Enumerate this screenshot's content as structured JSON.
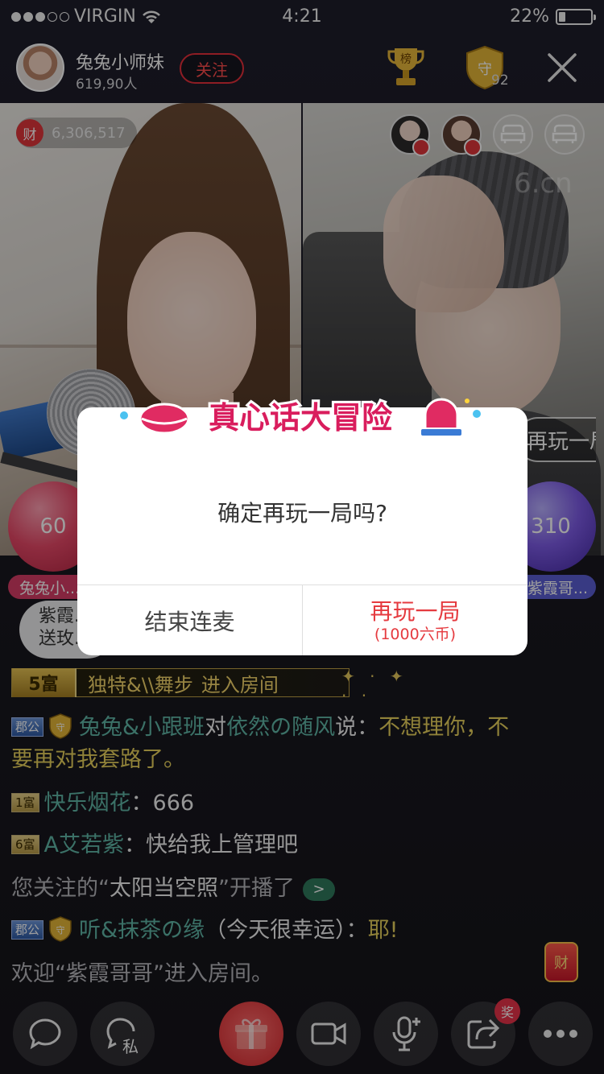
{
  "status_bar": {
    "carrier": "VIRGIN",
    "time": "4:21",
    "battery": "22%",
    "battery_level": 0.22
  },
  "header": {
    "host_name": "兔兔小师妹",
    "audience_count": "619,90人",
    "follow_label": "关注",
    "rank_label": "榜",
    "guard_label": "守",
    "guard_count": "92"
  },
  "left_stream": {
    "wealth_label": "财",
    "wealth_value": "6,306,517",
    "score": "60",
    "name": "兔兔小...",
    "gift_notice": [
      "紫霞...",
      "送玫..."
    ]
  },
  "right_stream": {
    "watermark": "6.cn",
    "play_again_pill": "再玩一局",
    "score": "310",
    "name": "紫霞哥..."
  },
  "dialog": {
    "title": "真心话大冒险",
    "message": "确定再玩一局吗?",
    "end_button": "结束连麦",
    "again_button": "再玩一局",
    "again_cost": "(1000六币)"
  },
  "chat": {
    "enter_banner": {
      "badge": "5富",
      "name": "独特&\\\\舞步",
      "text": "进入房间"
    },
    "messages": [
      {
        "badge": "郡公",
        "user": "兔兔&小跟班",
        "to": "对",
        "target": "依然の随风",
        "said": "说：",
        "text": "不想理你，不要再对我套路了。"
      },
      {
        "badge": "1富",
        "user": "快乐烟花",
        "colon": "：",
        "text": "666"
      },
      {
        "badge": "6富",
        "user": "A艾若紫",
        "colon": "：",
        "text": "快给我上管理吧"
      },
      {
        "prefix": "您关注的“",
        "name": "太阳当空照",
        "suffix": "”开播了",
        "chip": ">"
      },
      {
        "badge": "郡公",
        "user": "听&抹茶の缘",
        "middle": "（今天很幸运）：",
        "text": "耶!"
      },
      {
        "text": "欢迎“紫霞哥哥”进入房间。"
      }
    ],
    "wealth_corner": "财"
  },
  "bottom_bar": {
    "private_label": "私",
    "reward_badge": "奖"
  },
  "colors": {
    "accent_red": "#e53a3f",
    "chat_name_green": "#5fb7a7",
    "chat_gold": "#e8d25c"
  }
}
